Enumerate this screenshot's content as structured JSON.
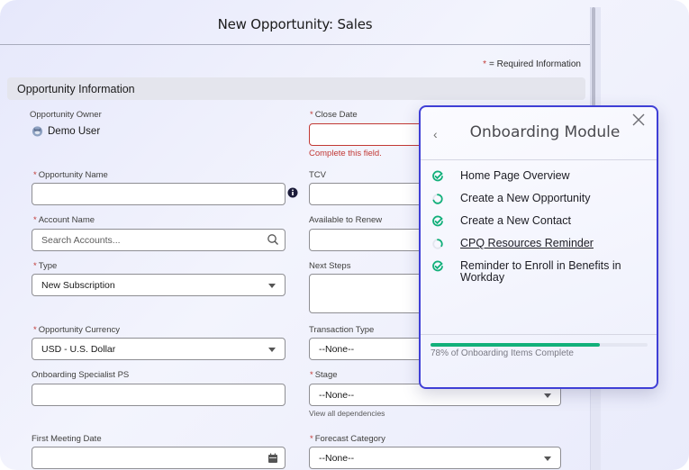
{
  "header": {
    "title": "New Opportunity: Sales",
    "required_note_star": "*",
    "required_note": "= Required Information"
  },
  "section": {
    "title": "Opportunity Information"
  },
  "left_fields": {
    "owner": {
      "label": "Opportunity Owner",
      "value": "Demo User",
      "icon": "user-avatar-icon"
    },
    "opportunity_name": {
      "label": "Opportunity Name",
      "required": true,
      "value": "",
      "icon": "info-icon"
    },
    "account_name": {
      "label": "Account Name",
      "required": true,
      "placeholder": "Search Accounts...",
      "icon": "search-icon"
    },
    "type": {
      "label": "Type",
      "required": true,
      "value": "New Subscription"
    },
    "currency": {
      "label": "Opportunity Currency",
      "required": true,
      "value": "USD - U.S. Dollar"
    },
    "onboarding_specialist": {
      "label": "Onboarding Specialist PS",
      "value": ""
    },
    "first_meeting_date": {
      "label": "First Meeting Date",
      "value": "",
      "icon": "calendar-icon"
    }
  },
  "right_fields": {
    "close_date": {
      "label": "Close Date",
      "required": true,
      "value": "",
      "error": "Complete this field."
    },
    "tcv": {
      "label": "TCV",
      "value": ""
    },
    "available_to_renew": {
      "label": "Available to Renew",
      "value": ""
    },
    "next_steps": {
      "label": "Next Steps",
      "value": ""
    },
    "transaction_type": {
      "label": "Transaction Type",
      "value": "--None--"
    },
    "stage": {
      "label": "Stage",
      "required": true,
      "value": "--None--",
      "hint": "View all dependencies"
    },
    "forecast_category": {
      "label": "Forecast Category",
      "required": true,
      "value": "--None--"
    }
  },
  "onboarding": {
    "title": "Onboarding Module",
    "back_icon": "chevron-left-icon",
    "close_icon": "close-icon",
    "items": [
      {
        "label": "Home Page Overview",
        "status": "complete"
      },
      {
        "label": "Create a New Opportunity",
        "status": "in-progress"
      },
      {
        "label": "Create a New Contact",
        "status": "complete"
      },
      {
        "label": "CPQ Resources Reminder",
        "status": "started",
        "link": true
      },
      {
        "label": "Reminder to Enroll in Benefits in Workday",
        "status": "complete"
      }
    ],
    "progress_percent": 78,
    "progress_text": "78% of Onboarding Items Complete",
    "colors": {
      "accent": "#3f3fd6",
      "success": "#12b07a"
    }
  },
  "colors": {
    "required": "#c23934",
    "error": "#c23934"
  }
}
